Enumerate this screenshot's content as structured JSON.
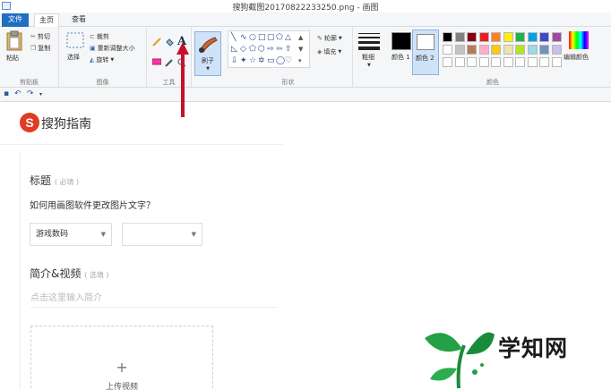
{
  "window": {
    "title": "搜狗截图20170822233250.png - 画图"
  },
  "tabs": [
    {
      "label": "文件"
    },
    {
      "label": "主页"
    },
    {
      "label": "查看"
    }
  ],
  "ribbon": {
    "clipboard": {
      "paste": "粘贴",
      "cut": "剪切",
      "copy": "复制",
      "group": "剪贴板"
    },
    "image": {
      "select": "选择",
      "crop": "裁剪",
      "resize": "重新调整大小",
      "rotate": "旋转",
      "group": "图像"
    },
    "tools": {
      "group": "工具",
      "text_glyph": "A"
    },
    "brushes": {
      "label": "刷子"
    },
    "shapes": {
      "outline": "轮廓",
      "fill": "填充",
      "group": "形状"
    },
    "size": {
      "label": "粗细"
    },
    "colors": {
      "color1": "颜色 1",
      "color2": "颜色 2",
      "edit": "编辑颜色",
      "group": "颜色",
      "palette_row1": [
        "#000000",
        "#7f7f7f",
        "#880015",
        "#ed1c24",
        "#ff7f27",
        "#fff200",
        "#22b14c",
        "#00a2e8",
        "#3f48cc",
        "#a349a4"
      ],
      "palette_row2": [
        "#ffffff",
        "#c3c3c3",
        "#b97a57",
        "#ffaec9",
        "#ffc90e",
        "#efe4b0",
        "#b5e61d",
        "#99d9ea",
        "#7092be",
        "#c8bfe7"
      ]
    }
  },
  "document": {
    "logo_text": "搜狗指南",
    "logo_mark": "S",
    "title_label": "标题",
    "title_hint": "( 必填 )",
    "question": "如何用画图软件更改图片文字？",
    "category_select": "游戏数码",
    "intro_label": "简介&视频",
    "intro_hint": "( 选填 )",
    "intro_placeholder": "点击这里输入简介",
    "upload_plus": "+",
    "upload_label": "上传视频",
    "watermark": "学知网"
  }
}
